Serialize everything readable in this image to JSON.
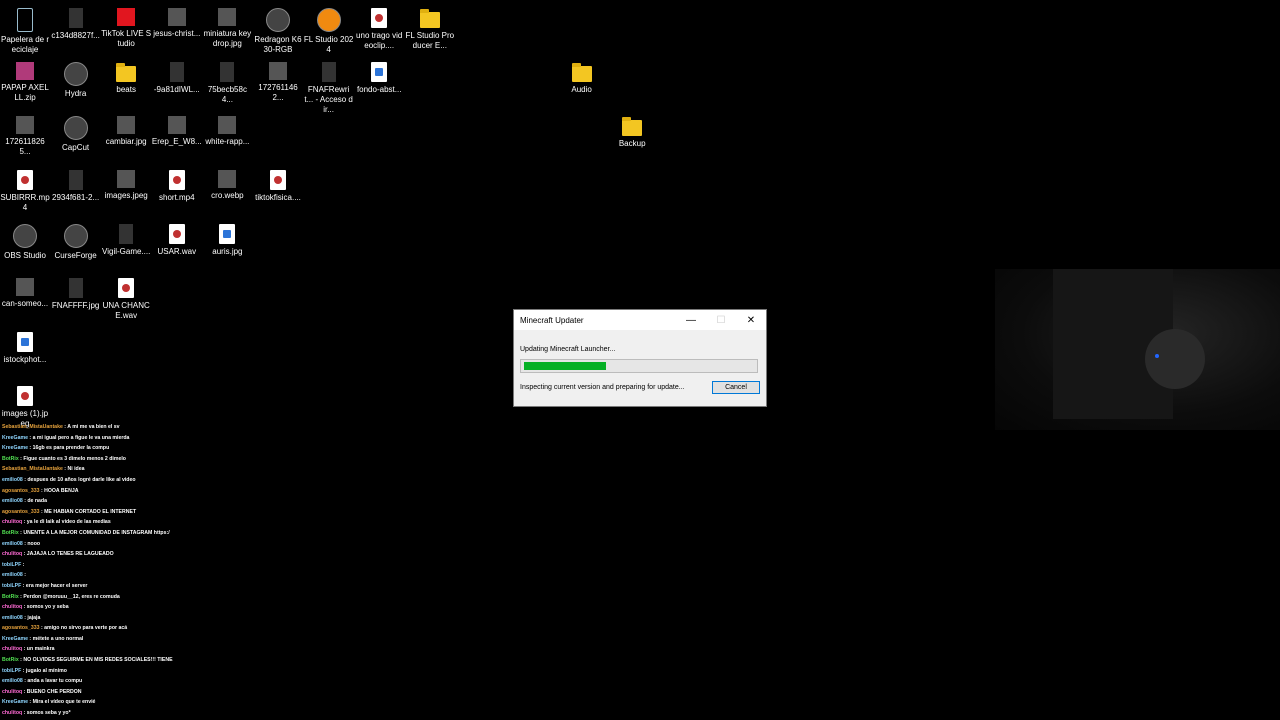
{
  "desktop": {
    "icons": [
      {
        "label": "Papelera de reciclaje",
        "type": "recycle",
        "col": 0,
        "row": 0
      },
      {
        "label": "c134d8827f...",
        "type": "dark",
        "col": 1,
        "row": 0
      },
      {
        "label": "TikTok LIVE Studio",
        "type": "tiktok",
        "col": 2,
        "row": 0
      },
      {
        "label": "jesus-christ...",
        "type": "thumb",
        "col": 3,
        "row": 0
      },
      {
        "label": "miniatura keydrop.jpg",
        "type": "thumb",
        "col": 4,
        "row": 0
      },
      {
        "label": "Redragon K630-RGB",
        "type": "app",
        "col": 5,
        "row": 0
      },
      {
        "label": "FL Studio 2024",
        "type": "flstudio",
        "col": 6,
        "row": 0
      },
      {
        "label": "uno trago videoclip....",
        "type": "file",
        "col": 7,
        "row": 0
      },
      {
        "label": "FL Studio Producer E...",
        "type": "folder",
        "col": 8,
        "row": 0
      },
      {
        "label": "PAPAP AXELLL.zip",
        "type": "zip",
        "col": 0,
        "row": 1
      },
      {
        "label": "Hydra",
        "type": "app",
        "col": 1,
        "row": 1
      },
      {
        "label": "beats",
        "type": "folder",
        "col": 2,
        "row": 1
      },
      {
        "label": "-9a81dIWL...",
        "type": "dark",
        "col": 3,
        "row": 1
      },
      {
        "label": "75becb58c4...",
        "type": "dark",
        "col": 4,
        "row": 1
      },
      {
        "label": "1727611462...",
        "type": "thumb",
        "col": 5,
        "row": 1
      },
      {
        "label": "FNAFRewrit... - Acceso dir...",
        "type": "dark",
        "col": 6,
        "row": 1
      },
      {
        "label": "fondo-abst...",
        "type": "fileblue",
        "col": 7,
        "row": 1
      },
      {
        "label": "Audio",
        "type": "folder",
        "col": 11,
        "row": 1
      },
      {
        "label": "1726118265...",
        "type": "thumb",
        "col": 0,
        "row": 2
      },
      {
        "label": "CapCut",
        "type": "app",
        "col": 1,
        "row": 2
      },
      {
        "label": "cambiar.jpg",
        "type": "thumb",
        "col": 2,
        "row": 2
      },
      {
        "label": "Erep_E_W8...",
        "type": "thumb",
        "col": 3,
        "row": 2
      },
      {
        "label": "white-rapp...",
        "type": "thumb",
        "col": 4,
        "row": 2
      },
      {
        "label": "Backup",
        "type": "folder",
        "col": 12,
        "row": 2
      },
      {
        "label": "SUBIRRR.mp4",
        "type": "file",
        "col": 0,
        "row": 3
      },
      {
        "label": "2934f681-2...",
        "type": "dark",
        "col": 1,
        "row": 3
      },
      {
        "label": "images.jpeg",
        "type": "thumb",
        "col": 2,
        "row": 3
      },
      {
        "label": "short.mp4",
        "type": "file",
        "col": 3,
        "row": 3
      },
      {
        "label": "cro.webp",
        "type": "thumb",
        "col": 4,
        "row": 3
      },
      {
        "label": "tiktokfisica....",
        "type": "file",
        "col": 5,
        "row": 3
      },
      {
        "label": "OBS Studio",
        "type": "obs",
        "col": 0,
        "row": 4
      },
      {
        "label": "CurseForge",
        "type": "app",
        "col": 1,
        "row": 4
      },
      {
        "label": "Vigil-Game....",
        "type": "dark",
        "col": 2,
        "row": 4
      },
      {
        "label": "USAR.wav",
        "type": "file",
        "col": 3,
        "row": 4
      },
      {
        "label": "auris.jpg",
        "type": "fileblue",
        "col": 4,
        "row": 4
      },
      {
        "label": "can-someo...",
        "type": "thumb",
        "col": 0,
        "row": 5
      },
      {
        "label": "FNAFFFF.jpg",
        "type": "dark",
        "col": 1,
        "row": 5
      },
      {
        "label": "UNA CHANCE.wav",
        "type": "file",
        "col": 2,
        "row": 5
      },
      {
        "label": "istockphot...",
        "type": "fileblue",
        "col": 0,
        "row": 6
      },
      {
        "label": "images (1).jpeg",
        "type": "file",
        "col": 0,
        "row": 7
      }
    ]
  },
  "chat": [
    {
      "user": "Sebastian_MistaUantake",
      "msg": ": A mi me va bien el sv",
      "color": "orange"
    },
    {
      "user": "KreeGame",
      "msg": ": a mi igual pero a figue le va una mierda",
      "color": "blue"
    },
    {
      "user": "KreeGame",
      "msg": ": 16gb es para prender la compu",
      "color": "blue"
    },
    {
      "user": "BotRix",
      "msg": ": Figue cuanto es 3 dimelo menos 2 dimelo",
      "color": "green"
    },
    {
      "user": "Sebastian_MistaUantake",
      "msg": ": Ni idea",
      "color": "orange"
    },
    {
      "user": "emilio08",
      "msg": ": despues de 10 años logré darle like al video",
      "color": "blue"
    },
    {
      "user": "agosantos_333",
      "msg": ": HOOA BENJA",
      "color": "orange"
    },
    {
      "user": "emilio08",
      "msg": ": de nada",
      "color": "blue"
    },
    {
      "user": "agosantos_333",
      "msg": ": ME HABIAN CORTADO EL INTERNET",
      "color": "orange"
    },
    {
      "user": "chulitoq",
      "msg": ": ya le di laik al video de las medias",
      "color": "pink"
    },
    {
      "user": "BotRix",
      "msg": ": UNENTE A LA MEJOR COMUNIDAD DE INSTAGRAM https:/",
      "color": "green"
    },
    {
      "user": "emilio08",
      "msg": ": nooo",
      "color": "blue"
    },
    {
      "user": "chulitoq",
      "msg": ": JAJAJA LO TENES RE LAGUEADO",
      "color": "pink"
    },
    {
      "user": "tobiLPF",
      "msg": ":",
      "color": "blue"
    },
    {
      "user": "emilio08",
      "msg": ":",
      "color": "blue"
    },
    {
      "user": "tobiLPF",
      "msg": ": era mejor hacer el server",
      "color": "blue"
    },
    {
      "user": "BotRix",
      "msg": ": Perdon @moruuu__12, eres re comuda",
      "color": "green"
    },
    {
      "user": "chulitoq",
      "msg": ": somos yo y seba",
      "color": "pink"
    },
    {
      "user": "emilio08",
      "msg": ": jajaja",
      "color": "blue"
    },
    {
      "user": "agosantos_333",
      "msg": ": amigo no sirvo para verte por acá",
      "color": "orange"
    },
    {
      "user": "KreeGame",
      "msg": ": métete a uno normal",
      "color": "blue"
    },
    {
      "user": "chulitoq",
      "msg": ": un mainkra",
      "color": "pink"
    },
    {
      "user": "BotRix",
      "msg": ": NO OLVIDES SEGUIRME EN MIS REDES SOCIALES!!! TIENE",
      "color": "green"
    },
    {
      "user": "tobiLPF",
      "msg": ": jugalo al mínimo",
      "color": "blue"
    },
    {
      "user": "emilio08",
      "msg": ": anda a lavar tu compu",
      "color": "blue"
    },
    {
      "user": "chulitoq",
      "msg": ": BUENO CHE PERDON",
      "color": "pink"
    },
    {
      "user": "KreeGame",
      "msg": ": Mira el vídeo que te envié",
      "color": "blue"
    },
    {
      "user": "chulitoq",
      "msg": ": somos seba y yo*",
      "color": "pink"
    }
  ],
  "dialog": {
    "title": "Minecraft Updater",
    "status_line": "Updating Minecraft Launcher...",
    "detail_line": "Inspecting current version and preparing for update...",
    "progress_fraction": 0.36,
    "cancel_label": "Cancel",
    "minimize_glyph": "—",
    "maximize_glyph": "☐",
    "close_glyph": "✕"
  },
  "colors": {
    "progress_fill": "#06b025",
    "desktop_bg": "#000000",
    "button_border": "#0078d7"
  }
}
